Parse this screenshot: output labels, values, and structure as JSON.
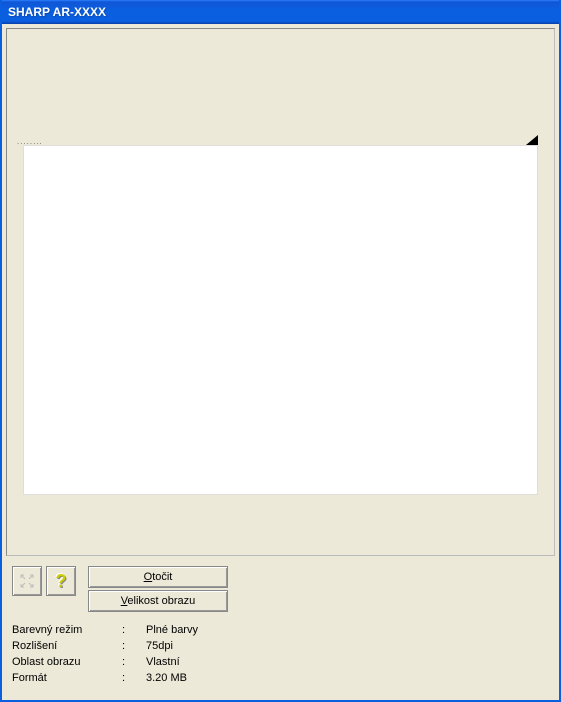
{
  "window": {
    "title": "SHARP AR-XXXX"
  },
  "buttons": {
    "rotate_prefix": "O",
    "rotate_suffix": "točit",
    "imagesize_prefix": "V",
    "imagesize_suffix": "elikost obrazu"
  },
  "icons": {
    "help_glyph": "?"
  },
  "info": {
    "separator": ":",
    "color_mode_label": "Barevný režim",
    "color_mode_value": "Plné barvy",
    "resolution_label": "Rozlišení",
    "resolution_value": "75dpi",
    "image_area_label": "Oblast obrazu",
    "image_area_value": "Vlastní",
    "format_label": "Formát",
    "format_value": "3.20 MB"
  }
}
